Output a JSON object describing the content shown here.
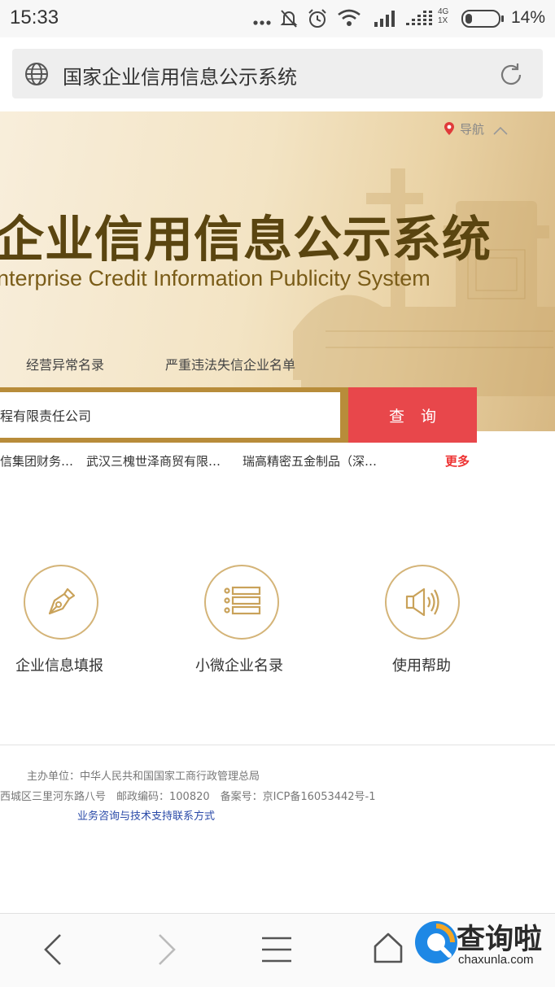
{
  "status_bar": {
    "time": "15:33",
    "network": "4G\n1X",
    "battery": "14%"
  },
  "address_bar": {
    "url_title": "国家企业信用信息公示系统"
  },
  "banner": {
    "nav_label": "导航",
    "title": "企业信用信息公示系统",
    "subtitle": "nterprise Credit Information Publicity System",
    "links": [
      "经营异常名录",
      "严重违法失信企业名单"
    ]
  },
  "search": {
    "value": "程有限责任公司",
    "button_label": "查询"
  },
  "hot_list": {
    "items": [
      "信集团财务…",
      "武汉三槐世泽商贸有限…",
      "瑞高精密五金制品（深…"
    ],
    "more_label": "更多"
  },
  "menu": {
    "items": [
      {
        "label": "企业信息填报",
        "icon": "pen-nib-icon"
      },
      {
        "label": "小微企业名录",
        "icon": "list-icon"
      },
      {
        "label": "使用帮助",
        "icon": "speaker-icon"
      }
    ]
  },
  "footer": {
    "sponsor": "主办单位：中华人民共和国国家工商行政管理总局",
    "address": "西城区三里河东路八号　邮政编码：100820　备案号：京ICP备16053442号-1",
    "contact_link": "业务咨询与技术支持联系方式"
  },
  "watermark": {
    "text": "查询啦",
    "url": "chaxunla.com"
  },
  "colors": {
    "accent_gold": "#b88c3a",
    "search_button": "#e8474b",
    "more_red": "#e33333",
    "contact_blue": "#2a4aa8"
  }
}
